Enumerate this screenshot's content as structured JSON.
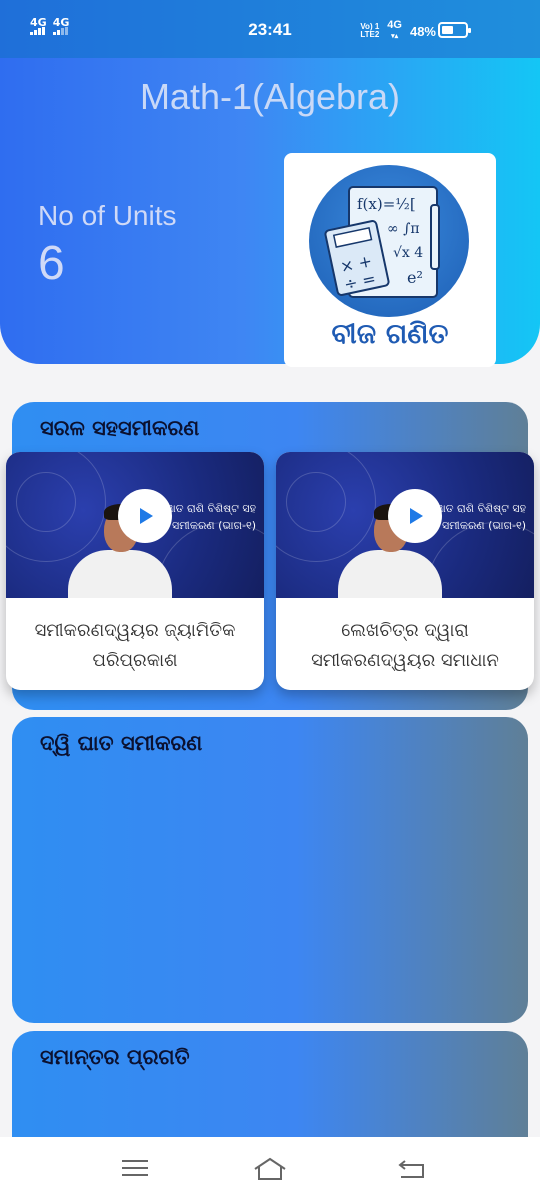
{
  "status": {
    "net1": "4G",
    "net2": "4G",
    "time": "23:41",
    "volte": "Vo) 1",
    "lte": "LTE2",
    "net3": "4G",
    "battery": "48%"
  },
  "header": {
    "title": "Math-1(Algebra)",
    "units_label": "No of Units",
    "units_value": "6",
    "subject_name": "ବୀଜ ଗଣିତ",
    "subject_icon": "algebra-calculator-illustration"
  },
  "units": [
    {
      "title": "ସରଳ ସହସମୀକରଣ",
      "videos": [
        {
          "thumb_text": "ଅଜ୍ଞାତ ରାଶି ବିଶିଷ୍ଟ ସହ ସମୀକରଣ (ଭାଗ-୧)",
          "title": "ସମୀକରଣଦ୍ୱୟର ଜ୍ୟାମିତିକ ପରିପ୍ରକାଶ"
        },
        {
          "thumb_text": "ଅଜ୍ଞାତ ରାଶି ବିଶିଷ୍ଟ ସହ ସମୀକରଣ (ଭାଗ-୧)",
          "title": "ଲେଖଚିତ୍ର ଦ୍ୱାରା ସମୀକରଣଦ୍ୱୟର ସମାଧାନ"
        }
      ]
    },
    {
      "title": "ଦ୍ୱି ଘାତ ସମୀକରଣ"
    },
    {
      "title": "ସମାନ୍ତର ପ୍ରଗତି"
    }
  ],
  "nav": {
    "menu_icon": "menu-icon",
    "home_icon": "home-icon",
    "back_icon": "back-icon"
  }
}
